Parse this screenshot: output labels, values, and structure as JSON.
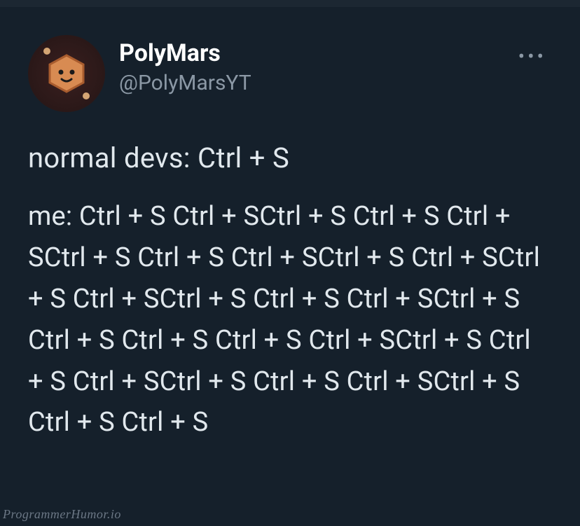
{
  "tweet": {
    "author": {
      "display_name": "PolyMars",
      "handle": "@PolyMarsYT"
    },
    "body": {
      "line1": "normal devs: Ctrl + S",
      "line2": "me: Ctrl + S Ctrl + SCtrl + S Ctrl + S Ctrl + SCtrl + S Ctrl + S Ctrl + SCtrl + S Ctrl + SCtrl + S Ctrl + SCtrl + S Ctrl + S Ctrl + SCtrl + S  Ctrl + S Ctrl + S Ctrl + S Ctrl + SCtrl + S Ctrl + S Ctrl + SCtrl + S Ctrl + S Ctrl + SCtrl + S Ctrl + S Ctrl + S"
    }
  },
  "watermark": "ProgrammerHumor.io"
}
